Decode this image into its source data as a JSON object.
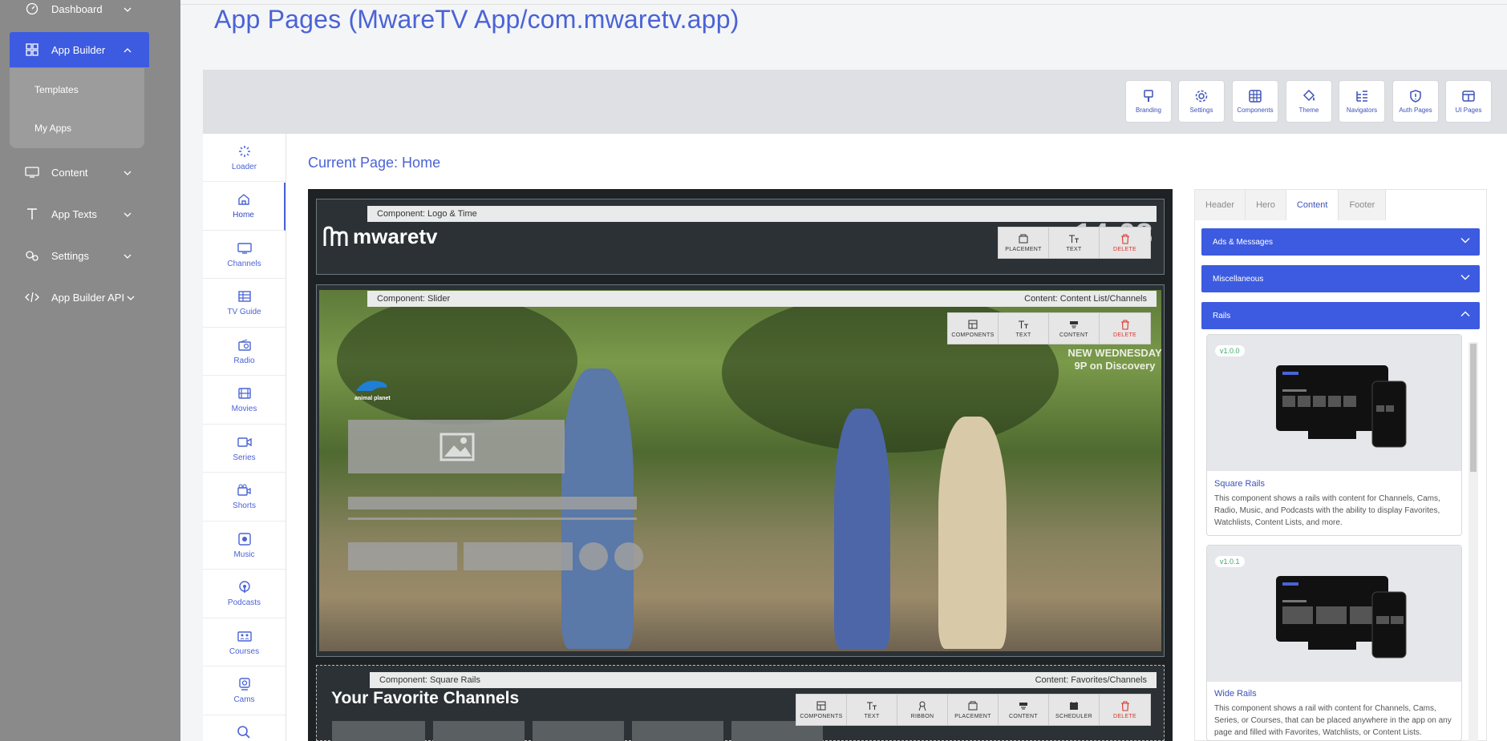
{
  "title": "App Pages (MwareTV App/com.mwaretv.app)",
  "current_page": "Current Page: Home",
  "nav": {
    "dashboard": "Dashboard",
    "app_builder": "App Builder",
    "templates": "Templates",
    "my_apps": "My Apps",
    "content": "Content",
    "app_texts": "App Texts",
    "settings": "Settings",
    "app_builder_api": "App Builder API"
  },
  "toolbar": [
    {
      "label": "Branding",
      "icon": "brush-icon"
    },
    {
      "label": "Settings",
      "icon": "gear-icon"
    },
    {
      "label": "Components",
      "icon": "grid-icon"
    },
    {
      "label": "Theme",
      "icon": "paint-bucket-icon"
    },
    {
      "label": "Navigators",
      "icon": "tree-icon"
    },
    {
      "label": "Auth Pages",
      "icon": "shield-icon"
    },
    {
      "label": "UI Pages",
      "icon": "layout-icon"
    }
  ],
  "pages": [
    {
      "label": "Loader",
      "icon": "loader-icon"
    },
    {
      "label": "Home",
      "icon": "home-icon"
    },
    {
      "label": "Channels",
      "icon": "tv-icon"
    },
    {
      "label": "TV Guide",
      "icon": "guide-icon"
    },
    {
      "label": "Radio",
      "icon": "radio-icon"
    },
    {
      "label": "Movies",
      "icon": "film-icon"
    },
    {
      "label": "Series",
      "icon": "video-icon"
    },
    {
      "label": "Shorts",
      "icon": "shorts-icon"
    },
    {
      "label": "Music",
      "icon": "music-icon"
    },
    {
      "label": "Podcasts",
      "icon": "podcast-icon"
    },
    {
      "label": "Courses",
      "icon": "courses-icon"
    },
    {
      "label": "Cams",
      "icon": "webcam-icon"
    }
  ],
  "components": {
    "logo_time": {
      "label": "Component: Logo & Time",
      "logo": "mwaretv",
      "time": "14:08"
    },
    "slider": {
      "label": "Component: Slider",
      "content": "Content: Content List/Channels",
      "promo": "NEW WEDNESDAY 9P on Discovery",
      "channel_logo": "animal planet"
    },
    "square_rails": {
      "label": "Component: Square Rails",
      "content": "Content: Favorites/Channels",
      "heading": "Your Favorite Channels"
    }
  },
  "actions": {
    "placement": "PLACEMENT",
    "text": "TEXT",
    "delete": "DELETE",
    "components": "COMPONENTS",
    "content": "CONTENT",
    "ribbon": "RIBBON",
    "scheduler": "SCHEDULER"
  },
  "right_panel": {
    "tabs": [
      "Header",
      "Hero",
      "Content",
      "Footer"
    ],
    "active_tab": "Content",
    "accordions": [
      "Ads & Messages",
      "Miscellaneous",
      "Rails"
    ],
    "cards": [
      {
        "version": "v1.0.0",
        "title": "Square Rails",
        "description": "This component shows a rails with content for Channels, Cams, Radio, Music, and Podcasts with the ability to display Favorites, Watchlists, Content Lists, and more."
      },
      {
        "version": "v1.0.1",
        "title": "Wide Rails",
        "description": "This component shows a rail with content for Channels, Cams, Series, or Courses, that can be placed anywhere in the app on any page and filled with Favorites, Watchlists, or Content Lists."
      }
    ]
  },
  "colors": {
    "accent": "#3d5be0",
    "title": "#4a63d6",
    "delete": "#d9342b",
    "nav_bg": "#8a8a8a"
  }
}
